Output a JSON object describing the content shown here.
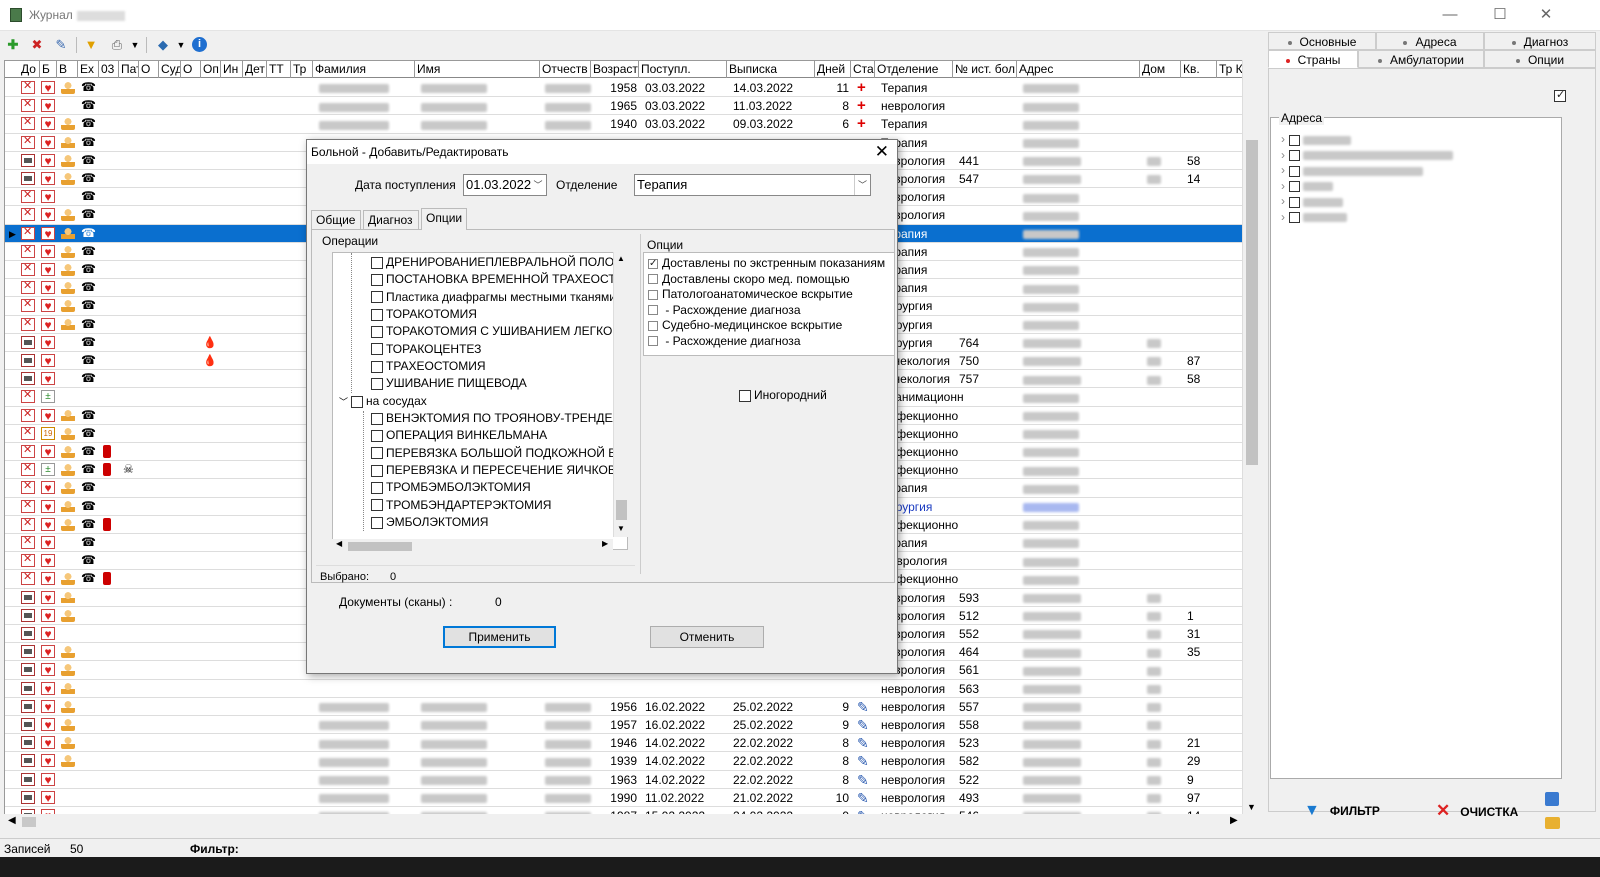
{
  "window": {
    "title": "Журнал",
    "minimize": "—",
    "maximize": "☐",
    "close": "✕"
  },
  "toolbar": {
    "icons": [
      "add-record-icon",
      "delete-record-icon",
      "edit-record-icon",
      "filter-icon",
      "print-icon",
      "book-icon",
      "info-icon"
    ]
  },
  "grid": {
    "columns": [
      "До",
      "Б",
      "В",
      "Ex",
      "03",
      "Пат",
      "О",
      "Суд",
      "О",
      "Оп",
      "Ин",
      "Дет",
      "ТТ",
      "Тр",
      "Фамилия",
      "Имя",
      "Отчеств",
      "Возраст",
      "Поступл.",
      "Выписка",
      "Дней",
      "Ста",
      "Отделение",
      "№ ист. бол",
      "Адрес",
      "Дом",
      "Кв.",
      "Тр К"
    ],
    "rows": [
      {
        "icons": [
          "x",
          "heart",
          "person",
          "phone"
        ],
        "age": "1958",
        "in": "03.03.2022",
        "out": "14.03.2022",
        "days": "11",
        "st": "+",
        "dept": "Терапия",
        "hist": "",
        "house": "",
        "flat": ""
      },
      {
        "icons": [
          "x",
          "heart",
          "",
          "phone"
        ],
        "age": "1965",
        "in": "03.03.2022",
        "out": "11.03.2022",
        "days": "8",
        "st": "+",
        "dept": "неврология",
        "hist": "",
        "house": "",
        "flat": ""
      },
      {
        "icons": [
          "x",
          "heart",
          "person",
          "phone"
        ],
        "age": "1940",
        "in": "03.03.2022",
        "out": "09.03.2022",
        "days": "6",
        "st": "+",
        "dept": "Терапия",
        "hist": "",
        "house": "",
        "flat": ""
      },
      {
        "icons": [
          "x",
          "heart",
          "person",
          "phone"
        ],
        "dept": "Терапия"
      },
      {
        "icons": [
          "doc",
          "heart",
          "person",
          "phone"
        ],
        "dept": "неврология",
        "hist": "441",
        "flat": "58"
      },
      {
        "icons": [
          "doc",
          "heart",
          "person",
          "phone"
        ],
        "dept": "неврология",
        "hist": "547",
        "flat": "14"
      },
      {
        "icons": [
          "x",
          "heart",
          "",
          "phone"
        ],
        "dept": "неврология"
      },
      {
        "icons": [
          "x",
          "heart",
          "person",
          "phone"
        ],
        "dept": "неврология"
      },
      {
        "icons": [
          "x",
          "heart",
          "person",
          "phone"
        ],
        "dept": "Терапия",
        "sel": true
      },
      {
        "icons": [
          "x",
          "heart",
          "person",
          "phone"
        ],
        "dept": "Терапия"
      },
      {
        "icons": [
          "x",
          "heart",
          "person",
          "phone"
        ],
        "dept": "Терапия"
      },
      {
        "icons": [
          "x",
          "heart",
          "person",
          "phone"
        ],
        "dept": "Терапия"
      },
      {
        "icons": [
          "x",
          "heart",
          "person",
          "phone"
        ],
        "dept": "Хирургия"
      },
      {
        "icons": [
          "x",
          "heart",
          "person",
          "phone"
        ],
        "dept": "Хирургия"
      },
      {
        "icons": [
          "doc",
          "heart",
          "",
          "phone"
        ],
        "dept": "Хирургия",
        "hist": "764",
        "blood": true
      },
      {
        "icons": [
          "doc",
          "heart",
          "",
          "phone"
        ],
        "dept": "Гинекология",
        "hist": "750",
        "flat": "87",
        "blood": true
      },
      {
        "icons": [
          "doc",
          "heart",
          "",
          "phone"
        ],
        "dept": "Гинекология",
        "hist": "757",
        "flat": "58"
      },
      {
        "icons": [
          "x",
          "plus",
          "",
          ""
        ],
        "dept": "Реанимационн"
      },
      {
        "icons": [
          "x",
          "heart",
          "person",
          "phone"
        ],
        "dept": "Инфекционно"
      },
      {
        "icons": [
          "x",
          "cal",
          "person",
          "phone"
        ],
        "dept": "Инфекционно"
      },
      {
        "icons": [
          "x",
          "heart",
          "person",
          "phone",
          "ext"
        ],
        "dept": "Инфекционно"
      },
      {
        "icons": [
          "x",
          "plus",
          "person",
          "phone",
          "ext",
          "skull"
        ],
        "dept": "Инфекционно"
      },
      {
        "icons": [
          "x",
          "heart",
          "person",
          "phone"
        ],
        "dept": "Терапия"
      },
      {
        "icons": [
          "x",
          "heart",
          "person",
          "phone"
        ],
        "dept": "Хирургия",
        "blue": true
      },
      {
        "icons": [
          "x",
          "heart",
          "person",
          "phone",
          "ext"
        ],
        "dept": "Инфекционно"
      },
      {
        "icons": [
          "x",
          "heart",
          "",
          "phone"
        ],
        "dept": "Терапия"
      },
      {
        "icons": [
          "x",
          "heart",
          "",
          "phone"
        ],
        "dept": "Неврология"
      },
      {
        "icons": [
          "x",
          "heart",
          "person",
          "phone",
          "ext"
        ],
        "dept": "Инфекционно"
      },
      {
        "icons": [
          "doc",
          "heart",
          "person",
          ""
        ],
        "dept": "неврология",
        "hist": "593"
      },
      {
        "icons": [
          "doc",
          "heart",
          "person",
          ""
        ],
        "dept": "неврология",
        "hist": "512",
        "flat": "1"
      },
      {
        "icons": [
          "doc",
          "heart",
          "",
          ""
        ],
        "dept": "неврология",
        "hist": "552",
        "flat": "31"
      },
      {
        "icons": [
          "doc",
          "heart",
          "person",
          ""
        ],
        "dept": "неврология",
        "hist": "464",
        "flat": "35"
      },
      {
        "icons": [
          "doc",
          "heart",
          "person",
          ""
        ],
        "dept": "неврология",
        "hist": "561"
      },
      {
        "icons": [
          "doc",
          "heart",
          "person",
          ""
        ],
        "dept": "неврология",
        "hist": "563"
      },
      {
        "icons": [
          "doc",
          "heart",
          "person",
          ""
        ],
        "age": "1956",
        "in": "16.02.2022",
        "out": "25.02.2022",
        "days": "9",
        "st": "pen",
        "dept": "неврология",
        "hist": "557"
      },
      {
        "icons": [
          "doc",
          "heart",
          "person",
          ""
        ],
        "age": "1957",
        "in": "16.02.2022",
        "out": "25.02.2022",
        "days": "9",
        "st": "pen",
        "dept": "неврология",
        "hist": "558"
      },
      {
        "icons": [
          "doc",
          "heart",
          "person",
          ""
        ],
        "age": "1946",
        "in": "14.02.2022",
        "out": "22.02.2022",
        "days": "8",
        "st": "pen",
        "dept": "неврология",
        "hist": "523",
        "flat": "21"
      },
      {
        "icons": [
          "doc",
          "heart",
          "person",
          ""
        ],
        "age": "1939",
        "in": "14.02.2022",
        "out": "22.02.2022",
        "days": "8",
        "st": "pen",
        "dept": "неврология",
        "hist": "582",
        "flat": "29"
      },
      {
        "icons": [
          "doc",
          "heart",
          "",
          ""
        ],
        "age": "1963",
        "in": "14.02.2022",
        "out": "22.02.2022",
        "days": "8",
        "st": "pen",
        "dept": "неврология",
        "hist": "522",
        "flat": "9"
      },
      {
        "icons": [
          "doc",
          "heart",
          "",
          ""
        ],
        "age": "1990",
        "in": "11.02.2022",
        "out": "21.02.2022",
        "days": "10",
        "st": "pen",
        "dept": "неврология",
        "hist": "493",
        "flat": "97"
      },
      {
        "icons": [
          "doc",
          "heart",
          "",
          ""
        ],
        "age": "1987",
        "in": "15.02.2022",
        "out": "24.02.2022",
        "days": "9",
        "st": "pen",
        "dept": "неврология",
        "hist": "546",
        "flat": "14"
      }
    ]
  },
  "status": {
    "records_label": "Записей",
    "records_count": "50",
    "filter_label": "Фильтр:"
  },
  "right_panel": {
    "tabs_row1": [
      "Основные",
      "Адреса",
      "Диагноз"
    ],
    "tabs_row2": [
      "Страны",
      "Амбулатории",
      "Опции"
    ],
    "active_tab": "Страны",
    "addr_legend": "Адреса",
    "filter_button": "ФИЛЬТР",
    "clear_button": "ОЧИСТКА"
  },
  "dialog": {
    "title": "Больной - Добавить/Редактировать",
    "date_label": "Дата поступления",
    "date_value": "01.03.2022",
    "dept_label": "Отделение",
    "dept_value": "Терапия",
    "tabs": [
      "Общие",
      "Диагноз",
      "Опции"
    ],
    "active_tab": "Опции",
    "operations_label": "Операции",
    "operations": [
      "ДРЕНИРОВАНИЕПЛЕВРАЛЬНОЙ ПОЛОСТИ",
      "ПОСТАНОВКА ВРЕМЕННОЙ ТРАХЕОСТОМ",
      "Пластика диафрагмы местными тканями",
      "ТОРАКОТОМИЯ",
      "ТОРАКОТОМИЯ С УШИВАНИЕМ ЛЕГКОГО",
      "ТОРАКОЦЕНТЕЗ",
      "ТРАХЕОСТОМИЯ",
      "УШИВАНИЕ ПИЩЕВОДА"
    ],
    "vessels_group": "на сосудах",
    "vessel_operations": [
      "ВЕНЭКТОМИЯ ПО ТРОЯНОВУ-ТРЕНДЕЛЕМ",
      "ОПЕРАЦИЯ ВИНКЕЛЬМАНА",
      "ПЕРЕВЯЗКА БОЛЬШОЙ ПОДКОЖНОЙ ВЕН",
      "ПЕРЕВЯЗКА И ПЕРЕСЕЧЕНИЕ ЯИЧКОВОЙ В",
      "ТРОМБЭМБОЛЭКТОМИЯ",
      "ТРОМБЭНДАРТЕРЭКТОМИЯ",
      "ЭМБОЛЭКТОМИЯ"
    ],
    "selected_label": "Выбрано:",
    "selected_count": "0",
    "options_label": "Опции",
    "options": [
      {
        "label": "Доставлены по экстренным показаниям",
        "checked": true
      },
      {
        "label": "Доставлены скоро мед. помощью",
        "checked": false
      },
      {
        "label": "Патологоанатомическое вскрытие",
        "checked": false
      },
      {
        "label": " - Расхождение диагноза",
        "checked": false
      },
      {
        "label": "Судебно-медицинское вскрытие",
        "checked": false
      },
      {
        "label": " - Расхождение диагноза",
        "checked": false
      }
    ],
    "nonresident_label": "Иногородний",
    "docs_label": "Документы (сканы) :",
    "docs_count": "0",
    "apply_button": "Применить",
    "cancel_button": "Отменить"
  },
  "colors": {
    "selection": "#0a6fcf",
    "accent_red": "#d22",
    "apply_border": "#0078d7"
  }
}
